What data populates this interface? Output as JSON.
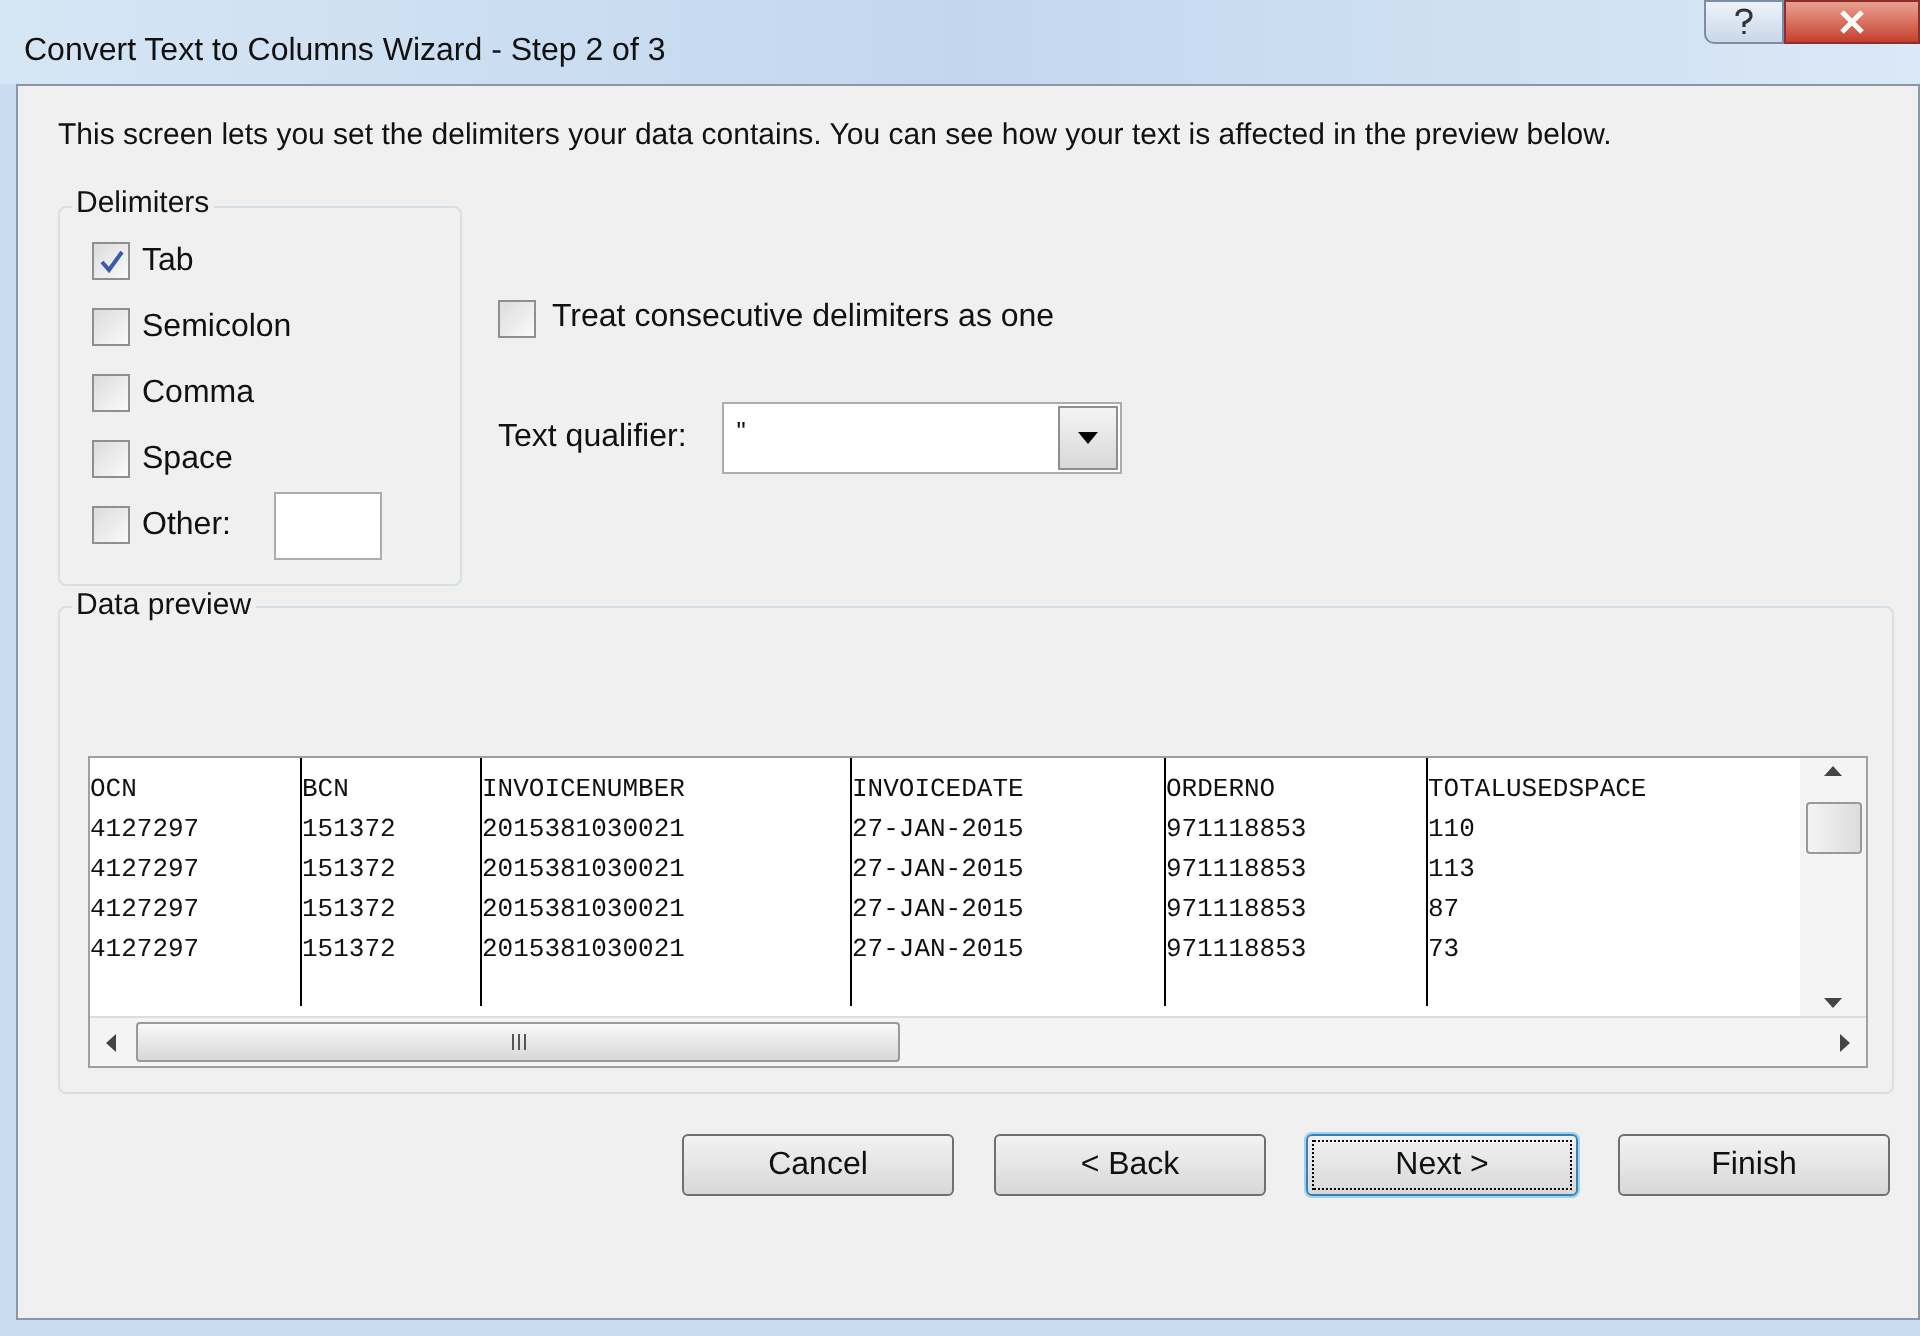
{
  "window": {
    "title": "Convert Text to Columns Wizard - Step 2 of 3"
  },
  "description": "This screen lets you set the delimiters your data contains.  You can see how your text is affected in the preview below.",
  "delimiters": {
    "label": "Delimiters",
    "options": [
      {
        "label": "Tab",
        "checked": true,
        "kind": "checkbox"
      },
      {
        "label": "Semicolon",
        "checked": false,
        "kind": "checkbox"
      },
      {
        "label": "Comma",
        "checked": false,
        "kind": "checkbox"
      },
      {
        "label": "Space",
        "checked": false,
        "kind": "checkbox"
      },
      {
        "label": "Other:",
        "checked": false,
        "kind": "other"
      }
    ]
  },
  "treat_consecutive": {
    "label": "Treat consecutive delimiters as one",
    "checked": false
  },
  "text_qualifier": {
    "label": "Text qualifier:",
    "value": "\""
  },
  "data_preview": {
    "label": "Data preview",
    "columns": [
      "OCN",
      "BCN",
      "INVOICENUMBER",
      "INVOICEDATE",
      "ORDERNO",
      "TOTALUSEDSPACE"
    ],
    "rows": [
      [
        "4127297",
        "151372",
        "2015381030021",
        "27-JAN-2015",
        "971118853",
        "110"
      ],
      [
        "4127297",
        "151372",
        "2015381030021",
        "27-JAN-2015",
        "971118853",
        "113"
      ],
      [
        "4127297",
        "151372",
        "2015381030021",
        "27-JAN-2015",
        "971118853",
        "87"
      ],
      [
        "4127297",
        "151372",
        "2015381030021",
        "27-JAN-2015",
        "971118853",
        "73"
      ]
    ]
  },
  "buttons": [
    {
      "label": "Cancel",
      "focused": false
    },
    {
      "label": "< Back",
      "focused": false
    },
    {
      "label": "Next >",
      "focused": true
    },
    {
      "label": "Finish",
      "focused": false
    }
  ]
}
